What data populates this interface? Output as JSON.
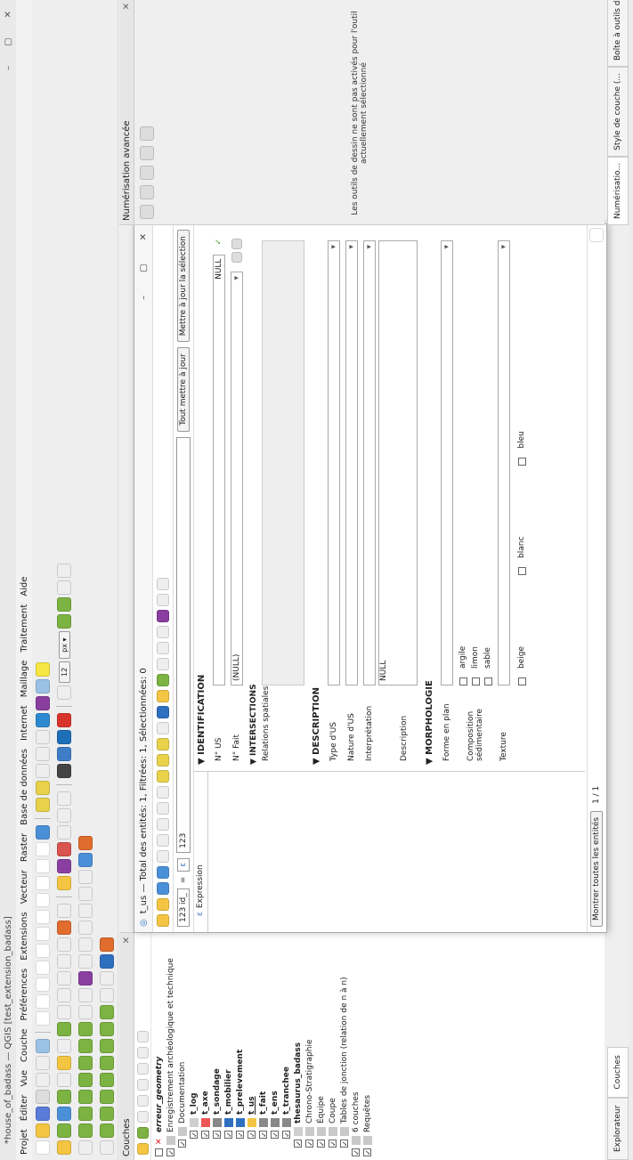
{
  "window": {
    "title": "*house_of_badass — QGIS [test_extension_badass]"
  },
  "menu": [
    "Projet",
    "Éditer",
    "Vue",
    "Couche",
    "Préférences",
    "Extensions",
    "Vecteur",
    "Raster",
    "Base de données",
    "Internet",
    "Maillage",
    "Traitement",
    "Aide"
  ],
  "layers_panel": {
    "title": "Couches",
    "items": [
      {
        "label": "erreur_geometry",
        "level": 0,
        "checked": false,
        "icon": "red-x-icon"
      },
      {
        "label": "Enregistrement archéologique et technique",
        "level": 0,
        "checked": true,
        "icon": "group-icon"
      },
      {
        "label": "Documentation",
        "level": 1,
        "checked": true,
        "icon": "group-icon"
      },
      {
        "label": "t_log",
        "level": 2,
        "checked": true,
        "icon": "table-icon"
      },
      {
        "label": "t_axe",
        "level": 2,
        "checked": true,
        "icon": "line-icon"
      },
      {
        "label": "t_sondage",
        "level": 2,
        "checked": true,
        "icon": "polygon-icon"
      },
      {
        "label": "t_mobilier",
        "level": 2,
        "checked": true,
        "icon": "point-icon"
      },
      {
        "label": "t_prelevement",
        "level": 2,
        "checked": true,
        "icon": "point-icon"
      },
      {
        "label": "t_us",
        "level": 2,
        "checked": true,
        "icon": "edit-icon"
      },
      {
        "label": "t_fait",
        "level": 2,
        "checked": true,
        "icon": "polygon-icon"
      },
      {
        "label": "t_ens",
        "level": 2,
        "checked": true,
        "icon": "polygon-icon"
      },
      {
        "label": "t_tranchee",
        "level": 2,
        "checked": true,
        "icon": "polygon-icon"
      },
      {
        "label": "thesaurus_badass",
        "level": 1,
        "checked": true,
        "icon": "table-icon"
      },
      {
        "label": "Chrono-Stratigraphie",
        "level": 1,
        "checked": true,
        "icon": "group-icon"
      },
      {
        "label": "Équipe",
        "level": 1,
        "checked": true,
        "icon": "group-icon"
      },
      {
        "label": "Coupe",
        "level": 1,
        "checked": true,
        "icon": "group-icon"
      },
      {
        "label": "Tables de jonction (relation de n à n)",
        "level": 1,
        "checked": true,
        "icon": "group-icon"
      },
      {
        "label": "6 couches",
        "level": 0,
        "checked": true,
        "icon": "group-icon"
      },
      {
        "label": "Requêtes",
        "level": 0,
        "checked": true,
        "icon": "group-icon"
      }
    ],
    "tabs": [
      "Explorateur",
      "Couches"
    ]
  },
  "dialog": {
    "title": "t_us — Total des entités: 1, Filtrées: 1, Sélectionnées: 0",
    "expression": {
      "field": "123 id_",
      "operator": "=",
      "value": "123",
      "label": "Expression"
    },
    "update_all": "Tout mettre à jour",
    "update_selection": "Mettre à jour la sélection",
    "fieldlist_header": "Expression",
    "footer_filter": "Montrer toutes les entités",
    "page": "1 / 1",
    "form": {
      "identification": "IDENTIFICATION",
      "n_us_label": "N° US",
      "n_us_null": "NULL",
      "n_fait_label": "N° Fait",
      "n_fait_value": "(NULL)",
      "intersections": "INTERSECTIONS",
      "relations_label": "Relations spatiales",
      "description": "DESCRIPTION",
      "type_us": "Type d'US",
      "nature_us": "Nature d'US",
      "interpretation": "Interprétation",
      "interpretation_value": "NULL",
      "description_label": "Description",
      "morphologie": "MORPHOLOGIE",
      "forme_plan": "Forme en plan",
      "composition": "Composition sédimentaire",
      "composition_options": [
        "argile",
        "limon",
        "sable"
      ],
      "texture": "Texture",
      "colors": [
        "beige",
        "blanc",
        "bleu"
      ]
    }
  },
  "right_panel": {
    "title": "Numérisation avancée",
    "message": "Les outils de dessin ne sont pas activés pour l'outil actuellement sélectionné",
    "tabs": [
      "Numérisatio...",
      "Style de couche (...",
      "Boîte à outils de tr..."
    ]
  },
  "colors": {
    "accent": "#2f6fc0",
    "error": "#d11a1a"
  }
}
